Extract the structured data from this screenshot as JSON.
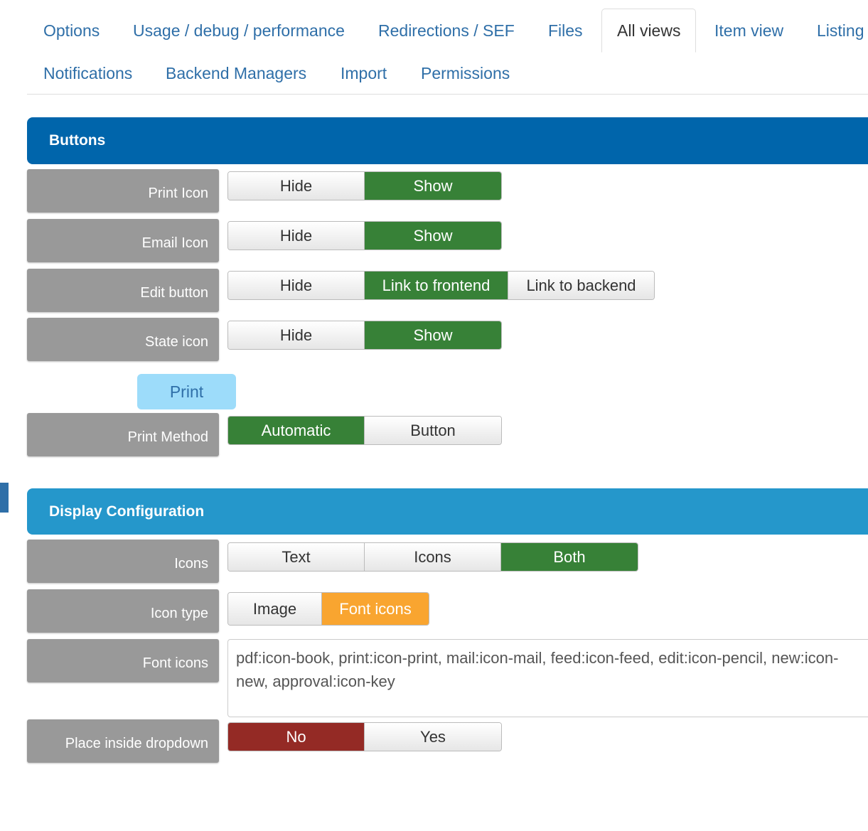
{
  "tabs": [
    {
      "label": "Options"
    },
    {
      "label": "Usage / debug / performance"
    },
    {
      "label": "Redirections / SEF"
    },
    {
      "label": "Files"
    },
    {
      "label": "All views",
      "active": true
    },
    {
      "label": "Item view"
    },
    {
      "label": "Listing"
    },
    {
      "label": "Notifications"
    },
    {
      "label": "Backend Managers"
    },
    {
      "label": "Import"
    },
    {
      "label": "Permissions"
    }
  ],
  "sections": {
    "buttons": {
      "title": "Buttons"
    },
    "display": {
      "title": "Display Configuration"
    }
  },
  "fields": {
    "print_icon": {
      "label": "Print Icon",
      "options": [
        "Hide",
        "Show"
      ],
      "selected": "Show"
    },
    "email_icon": {
      "label": "Email Icon",
      "options": [
        "Hide",
        "Show"
      ],
      "selected": "Show"
    },
    "edit_button": {
      "label": "Edit button",
      "options": [
        "Hide",
        "Link to frontend",
        "Link to backend"
      ],
      "selected": "Link to frontend"
    },
    "state_icon": {
      "label": "State icon",
      "options": [
        "Hide",
        "Show"
      ],
      "selected": "Show"
    },
    "print_button": {
      "label": "Print"
    },
    "print_method": {
      "label": "Print Method",
      "options": [
        "Automatic",
        "Button"
      ],
      "selected": "Automatic"
    },
    "icons": {
      "label": "Icons",
      "options": [
        "Text",
        "Icons",
        "Both"
      ],
      "selected": "Both"
    },
    "icon_type": {
      "label": "Icon type",
      "options": [
        "Image",
        "Font icons"
      ],
      "selected": "Font icons"
    },
    "font_icons": {
      "label": "Font icons",
      "value": "pdf:icon-book, print:icon-print, mail:icon-mail, feed:icon-feed, edit:icon-pencil, new:icon-new, approval:icon-key"
    },
    "dropdown": {
      "label": "Place inside dropdown",
      "options": [
        "No",
        "Yes"
      ],
      "selected": "No"
    }
  },
  "colors": {
    "tab_link": "#2f6fa8",
    "buttons_header": "#0065ab",
    "display_header": "#2597cb",
    "label_bg": "#999999",
    "selected_green": "#378137",
    "selected_orange": "#f9a530",
    "selected_red": "#942a25",
    "print_button_bg": "#9ddcfa"
  }
}
